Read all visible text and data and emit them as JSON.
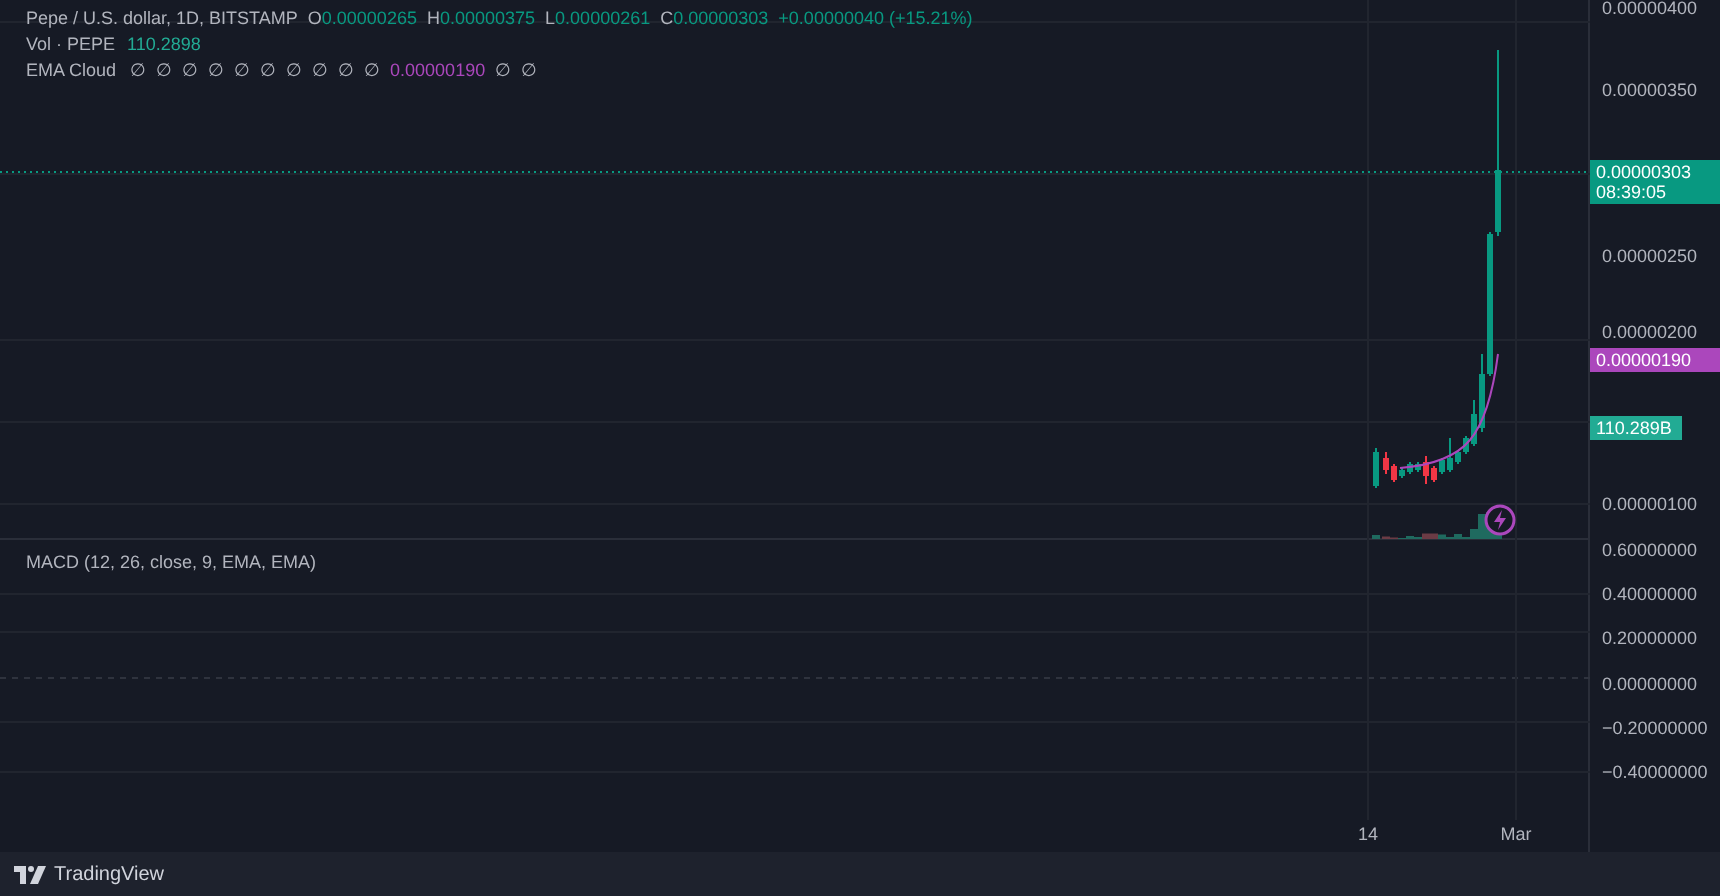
{
  "legend": {
    "title": "Pepe / U.S. dollar, 1D, BITSTAMP",
    "ohlc": [
      {
        "label": "O",
        "value": "0.00000265"
      },
      {
        "label": "H",
        "value": "0.00000375"
      },
      {
        "label": "L",
        "value": "0.00000261"
      },
      {
        "label": "C",
        "value": "0.00000303"
      }
    ],
    "change": "+0.00000040 (+15.21%)"
  },
  "volume": {
    "name": "Vol · PEPE",
    "value": "110.2898"
  },
  "ema": {
    "name": "EMA Cloud",
    "values": [
      {
        "kind": "empty",
        "text": "∅"
      },
      {
        "kind": "empty",
        "text": "∅"
      },
      {
        "kind": "empty",
        "text": "∅"
      },
      {
        "kind": "empty",
        "text": "∅"
      },
      {
        "kind": "empty",
        "text": "∅"
      },
      {
        "kind": "empty",
        "text": "∅"
      },
      {
        "kind": "empty",
        "text": "∅"
      },
      {
        "kind": "empty",
        "text": "∅"
      },
      {
        "kind": "empty",
        "text": "∅"
      },
      {
        "kind": "empty",
        "text": "∅"
      },
      {
        "kind": "value",
        "text": "0.00000190"
      },
      {
        "kind": "empty",
        "text": "∅"
      },
      {
        "kind": "empty",
        "text": "∅"
      }
    ]
  },
  "price_axis": [
    "0.00000400",
    "0.00000350",
    "0.00000250",
    "0.00000200",
    "0.00000100"
  ],
  "badges": [
    {
      "kind": "last",
      "text": "0.00000303",
      "countdown": "08:39:05"
    },
    {
      "kind": "ema",
      "text": "0.00000190"
    },
    {
      "kind": "volume",
      "text": "110.289B"
    }
  ],
  "macd": {
    "title": "MACD (12, 26, close, 9, EMA, EMA)",
    "axis": [
      "0.60000000",
      "0.40000000",
      "0.20000000",
      "0.00000000",
      "−0.20000000",
      "−0.40000000"
    ]
  },
  "time_axis": [
    "14",
    "Mar"
  ],
  "footer": {
    "brand": "TradingView"
  }
}
